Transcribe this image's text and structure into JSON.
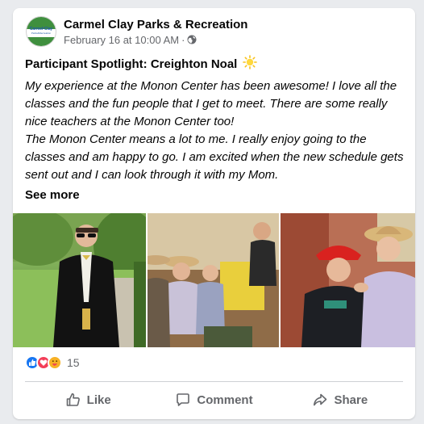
{
  "post": {
    "page_name": "Carmel Clay Parks & Recreation",
    "timestamp": "February 16 at 10:00 AM",
    "separator": "·",
    "privacy_icon": "globe-icon",
    "avatar": {
      "logo_text": "Carmel•Clay",
      "logo_sub": "Parks&Recreation"
    },
    "title": "Participant Spotlight: Creighton Noal",
    "title_emoji": "sun-emoji",
    "paragraphs": [
      "My experience at the Monon Center has been awesome! I love all the classes and the fun people that I get to meet. There are some really nice teachers at the Monon Center too!",
      "The Monon Center means a lot to me. I really enjoy going to the classes and am happy to go. I am excited when the new schedule gets sent out and I can look through it with my Mom."
    ],
    "see_more": "See more",
    "photos": [
      "photo-outdoor-portrait",
      "photo-group-class",
      "photo-hats-activity"
    ],
    "reactions": {
      "icons": [
        "like-reaction-icon",
        "love-reaction-icon",
        "care-reaction-icon"
      ],
      "count": "15"
    },
    "actions": {
      "like": "Like",
      "comment": "Comment",
      "share": "Share"
    }
  },
  "colors": {
    "background": "#e9ebee",
    "card": "#ffffff",
    "text": "#050505",
    "secondary_text": "#65676b",
    "brand_green": "#3f8f3e",
    "brand_blue": "#1f5aa8",
    "like_blue": "#1877f2",
    "love_red": "#f33e58"
  }
}
